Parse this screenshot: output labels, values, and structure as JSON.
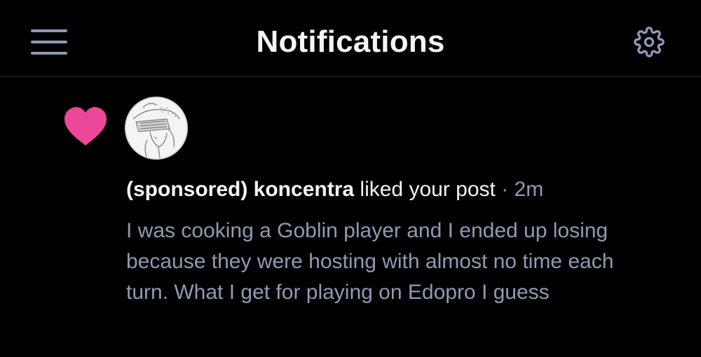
{
  "header": {
    "title": "Notifications",
    "menu_icon": "hamburger-menu-icon",
    "settings_icon": "gear-icon"
  },
  "notification": {
    "type_icon": "heart-icon",
    "type_color": "#ec4899",
    "user": "(sponsored) koncentra",
    "action": "liked your post",
    "separator": "·",
    "time": "2m",
    "post_text": "I was cooking a Goblin player and I ended up losing because they were hosting with almost no time each turn. What I get for playing on Edopro I guess"
  },
  "colors": {
    "background": "#000000",
    "primary_text": "#f2f4f7",
    "secondary_text": "#8f9bb3",
    "accent": "#ec4899"
  }
}
